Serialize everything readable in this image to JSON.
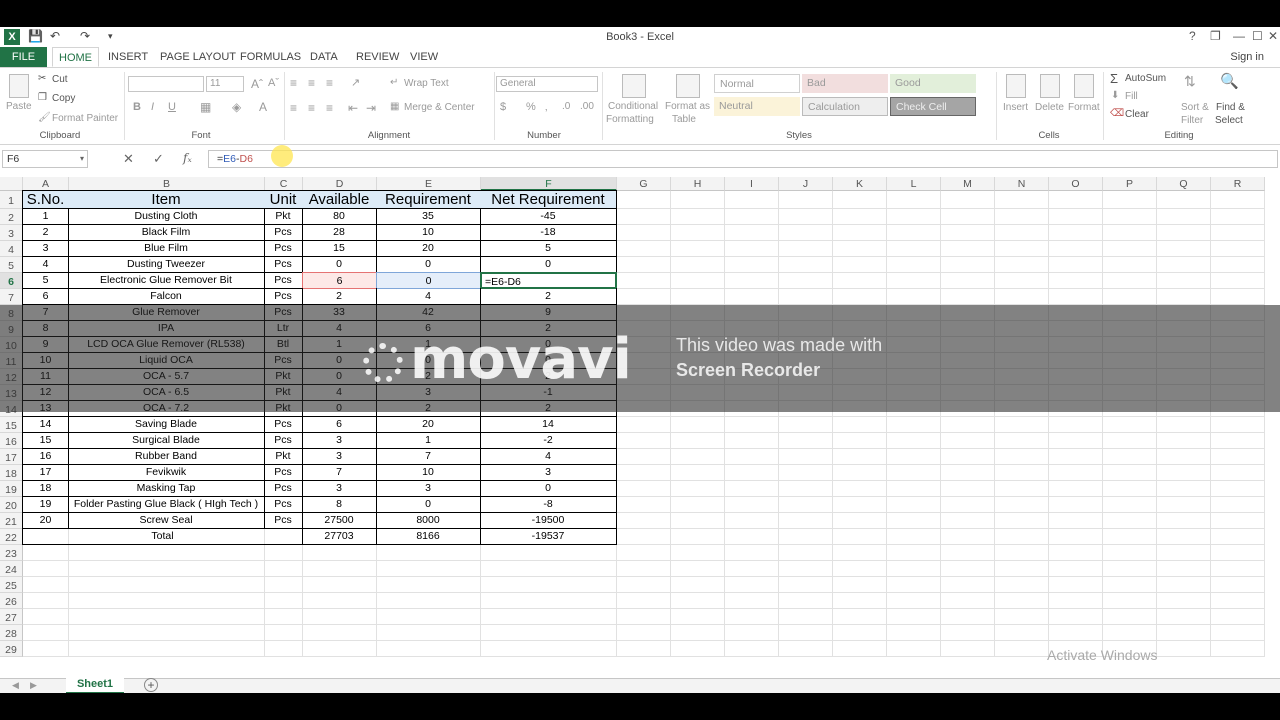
{
  "window": {
    "title": "Book3 - Excel",
    "help": "?",
    "controls": [
      "❐",
      "—",
      "☐",
      "✕"
    ]
  },
  "tabs": [
    "FILE",
    "HOME",
    "INSERT",
    "PAGE LAYOUT",
    "FORMULAS",
    "DATA",
    "REVIEW",
    "VIEW"
  ],
  "signin": "Sign in",
  "ribbon": {
    "clipboard": {
      "paste": "Paste",
      "cut": "Cut",
      "copy": "Copy",
      "format_painter": "Format Painter",
      "label": "Clipboard"
    },
    "font": {
      "size": "11",
      "label": "Font"
    },
    "alignment": {
      "wrap": "Wrap Text",
      "merge": "Merge & Center",
      "label": "Alignment"
    },
    "number": {
      "format": "General",
      "label": "Number"
    },
    "styles": {
      "conditional": "Conditional",
      "conditional2": "Formatting",
      "format_as": "Format as",
      "format_as2": "Table",
      "cells": [
        "Normal",
        "Bad",
        "Good",
        "Neutral",
        "Calculation",
        "Check Cell"
      ],
      "label": "Styles"
    },
    "cells": {
      "insert": "Insert",
      "delete": "Delete",
      "format": "Format",
      "label": "Cells"
    },
    "editing": {
      "autosum": "AutoSum",
      "fill": "Fill",
      "clear": "Clear",
      "sort": "Sort &",
      "sort2": "Filter",
      "find": "Find &",
      "find2": "Select",
      "label": "Editing"
    }
  },
  "formula_bar": {
    "name_box": "F6",
    "formula": "=E6-D6",
    "ref_e": "E6",
    "ref_d": "D6"
  },
  "columns": [
    "A",
    "B",
    "C",
    "D",
    "E",
    "F",
    "G",
    "H",
    "I",
    "J",
    "K",
    "L",
    "M",
    "N",
    "O",
    "P",
    "Q",
    "R"
  ],
  "headers": [
    "S.No.",
    "Item",
    "Unit",
    "Available",
    "Requirement",
    "Net Requirement"
  ],
  "rows": [
    [
      "1",
      "Dusting Cloth",
      "Pkt",
      "80",
      "35",
      "-45"
    ],
    [
      "2",
      "Black Film",
      "Pcs",
      "28",
      "10",
      "-18"
    ],
    [
      "3",
      "Blue Film",
      "Pcs",
      "15",
      "20",
      "5"
    ],
    [
      "4",
      "Dusting Tweezer",
      "Pcs",
      "0",
      "0",
      "0"
    ],
    [
      "5",
      "Electronic Glue Remover Bit",
      "Pcs",
      "6",
      "0",
      "=E6-D6"
    ],
    [
      "6",
      "Falcon",
      "Pcs",
      "2",
      "4",
      "2"
    ],
    [
      "7",
      "Glue Remover",
      "Pcs",
      "33",
      "42",
      "9"
    ],
    [
      "8",
      "IPA",
      "Ltr",
      "4",
      "6",
      "2"
    ],
    [
      "9",
      "LCD OCA Glue Remover (RL538)",
      "Btl",
      "1",
      "1",
      "0"
    ],
    [
      "10",
      "Liquid OCA",
      "Pcs",
      "0",
      "0",
      "0"
    ],
    [
      "11",
      "OCA - 5.7",
      "Pkt",
      "0",
      "2",
      "2"
    ],
    [
      "12",
      "OCA - 6.5",
      "Pkt",
      "4",
      "3",
      "-1"
    ],
    [
      "13",
      "OCA - 7.2",
      "Pkt",
      "0",
      "2",
      "2"
    ],
    [
      "14",
      "Saving Blade",
      "Pcs",
      "6",
      "20",
      "14"
    ],
    [
      "15",
      "Surgical Blade",
      "Pcs",
      "3",
      "1",
      "-2"
    ],
    [
      "16",
      "Rubber Band",
      "Pkt",
      "3",
      "7",
      "4"
    ],
    [
      "17",
      "Fevikwik",
      "Pcs",
      "7",
      "10",
      "3"
    ],
    [
      "18",
      "Masking Tap",
      "Pcs",
      "3",
      "3",
      "0"
    ],
    [
      "19",
      "Folder Pasting Glue Black ( HIgh Tech )",
      "Pcs",
      "8",
      "0",
      "-8"
    ],
    [
      "20",
      "Screw Seal",
      "Pcs",
      "27500",
      "8000",
      "-19500"
    ]
  ],
  "total": {
    "label": "Total",
    "available": "27703",
    "requirement": "8166",
    "net": "-19537"
  },
  "row_numbers": [
    "1",
    "2",
    "3",
    "4",
    "5",
    "6",
    "7",
    "8",
    "9",
    "10",
    "11",
    "12",
    "13",
    "14",
    "15",
    "16",
    "17",
    "18",
    "19",
    "20",
    "21",
    "22",
    "23",
    "24",
    "25",
    "26",
    "27",
    "28",
    "29"
  ],
  "watermark": {
    "logo": "movavi",
    "line1": "This video was made with",
    "line2": "Screen Recorder"
  },
  "sheet_tab": "Sheet1",
  "add_sheet": "+",
  "activate_windows": "Activate Windows",
  "colors": {
    "excel_green": "#217346",
    "header_fill": "#ddebf7",
    "ref_blue": "#2f5bb7",
    "ref_red": "#c0504d"
  }
}
